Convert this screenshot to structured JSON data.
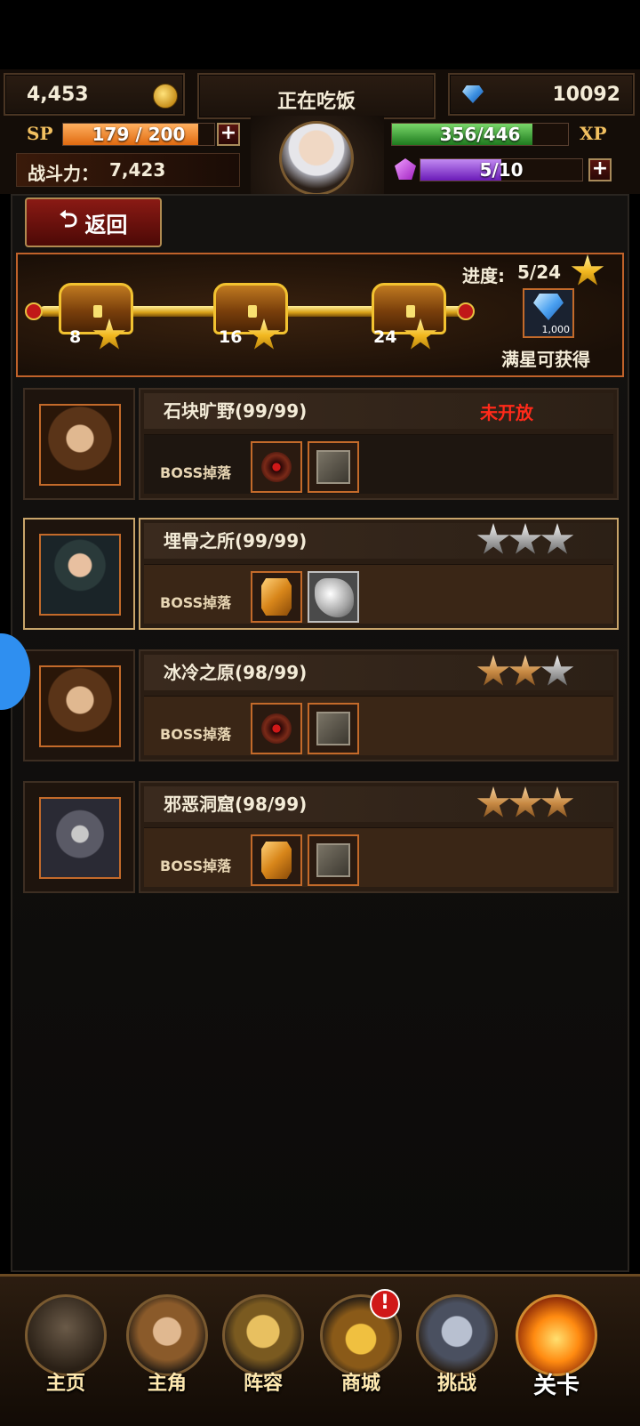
{
  "hud": {
    "gold": "4,453",
    "status": "正在吃饭",
    "diamonds": "10092",
    "sp_label": "SP",
    "sp_value": "179 / 200",
    "sp_fraction": 0.895,
    "xp_label": "XP",
    "xp_value": "356/446",
    "xp_fraction": 0.798,
    "combat_label": "战斗力：",
    "combat_value": "7,423",
    "energy_value": "5/10",
    "energy_fraction": 0.5,
    "plus": "+"
  },
  "back_button": {
    "label": "返回",
    "icon": "back-arrow-icon"
  },
  "progress": {
    "label": "进度:",
    "value": "5/24",
    "milestones": [
      "8",
      "16",
      "24"
    ],
    "reward_amount": "1,000",
    "reward_text": "满星可获得"
  },
  "stages": [
    {
      "name": "石块旷野(99/99)",
      "status": "未开放",
      "stars": 0,
      "drop_label": "BOSS掉落",
      "drops": [
        "blood-orb-icon",
        "tome-icon"
      ]
    },
    {
      "name": "埋骨之所(99/99)",
      "stars": 0,
      "drop_label": "BOSS掉落",
      "drops": [
        "amber-gem-icon",
        "silver-ore-icon"
      ]
    },
    {
      "name": "冰冷之原(98/99)",
      "stars": 2,
      "drop_label": "BOSS掉落",
      "drops": [
        "blood-orb-icon",
        "tome-icon"
      ]
    },
    {
      "name": "邪恶洞窟(98/99)",
      "stars": 3,
      "drop_label": "BOSS掉落",
      "drops": [
        "amber-gem-icon",
        "tome-icon"
      ]
    }
  ],
  "nav": [
    {
      "label": "主页",
      "icon": "castle-icon"
    },
    {
      "label": "主角",
      "icon": "hero-icon"
    },
    {
      "label": "阵容",
      "icon": "helmet-icon"
    },
    {
      "label": "商城",
      "icon": "treasure-chest-icon",
      "badge": "!"
    },
    {
      "label": "挑战",
      "icon": "crossed-axes-icon"
    },
    {
      "label": "关卡",
      "icon": "fire-emblem-icon",
      "active": true
    }
  ],
  "colors": {
    "sp_bar": "#f08a2a",
    "xp_bar": "#3aa83a",
    "energy_bar": "#8a3ad8",
    "locked": "#ff2a1a",
    "accent_border": "#c36a2a"
  }
}
